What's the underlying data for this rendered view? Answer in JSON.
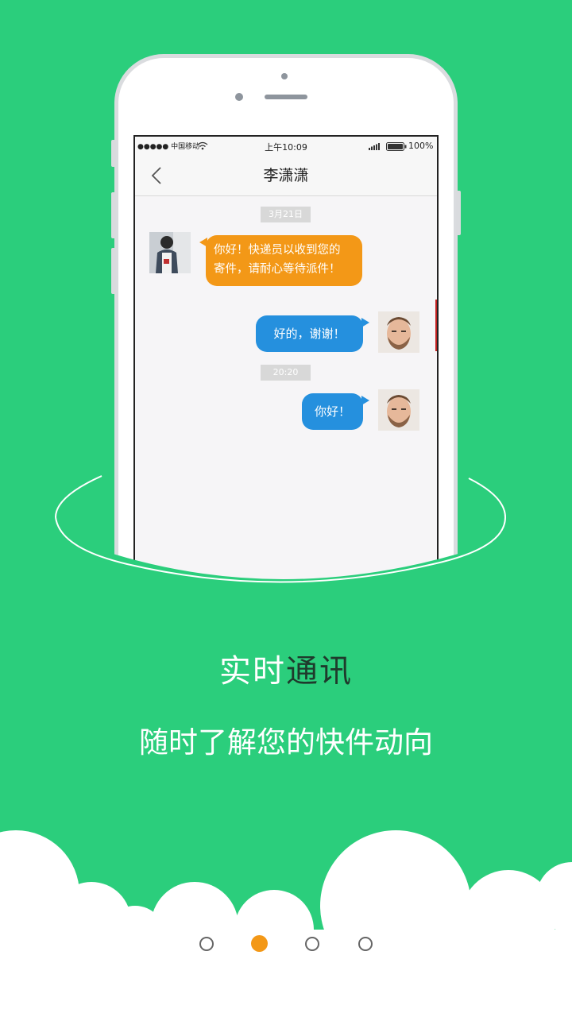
{
  "status_bar": {
    "carrier": "●●●●● 中国移动",
    "time": "上午10:09",
    "battery": "100%"
  },
  "chat": {
    "title": "李潇潇",
    "messages": [
      {
        "type": "timestamp",
        "text": "3月21日"
      },
      {
        "type": "incoming",
        "lines": [
          "你好！快递员以收到您的",
          "寄件，请耐心等待派件！"
        ]
      },
      {
        "type": "outgoing",
        "text": "好的，谢谢！"
      },
      {
        "type": "timestamp",
        "text": "20:20"
      },
      {
        "type": "outgoing",
        "text": "你好！"
      }
    ]
  },
  "feature": {
    "headline_light": "实时",
    "headline_dark": "通讯",
    "subtitle": "随时了解您的快件动向"
  },
  "pager": {
    "count": 4,
    "active_index": 1
  },
  "colors": {
    "background": "#2bce7c",
    "accent_orange": "#f39817",
    "bubble_blue": "#2590de",
    "headline_dark": "#1f3a2c"
  },
  "icons": [
    "back-chevron-icon",
    "wifi-icon",
    "signal-icon",
    "battery-icon"
  ]
}
